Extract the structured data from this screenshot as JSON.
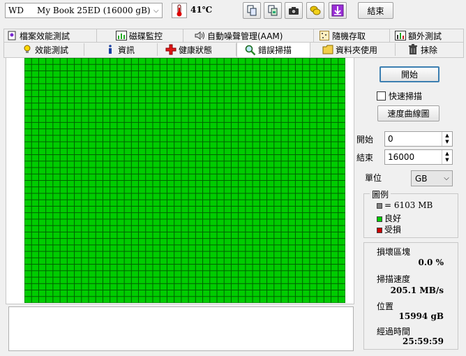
{
  "toolbar": {
    "drive_label": "WD     My Book 25ED (16000 gB)",
    "temperature": "41℃",
    "exit_label": "結束"
  },
  "tabs_row1": [
    {
      "label": "檔案效能測試"
    },
    {
      "label": "磁碟監控"
    },
    {
      "label": "自動噪聲管理(AAM)"
    },
    {
      "label": "隨機存取"
    },
    {
      "label": "額外測試"
    }
  ],
  "tabs_row2": [
    {
      "label": "效能測試"
    },
    {
      "label": "資訊"
    },
    {
      "label": "健康狀態"
    },
    {
      "label": "錯誤掃描"
    },
    {
      "label": "資料夾使用"
    },
    {
      "label": "抹除"
    }
  ],
  "scan": {
    "start_label": "開始",
    "quick_scan_label": "快速掃描",
    "quick_scan_checked": false,
    "speed_map_label": "速度曲線圖",
    "range_start_label": "開始",
    "range_start_value": "0",
    "range_end_label": "結束",
    "range_end_value": "16000",
    "unit_label": "單位",
    "unit_value": "GB",
    "grid_cols": 45,
    "grid_rows": 38,
    "block_color": "#00cc00"
  },
  "legend": {
    "title": "圖例",
    "items": [
      {
        "label": "= 6103 MB",
        "color": "#808080"
      },
      {
        "label": "良好",
        "color": "#00cc00"
      },
      {
        "label": "受損",
        "color": "#cc0000"
      }
    ]
  },
  "stats": {
    "damaged_label": "損壞區塊",
    "damaged_value": "0.0 %",
    "speed_label": "掃描速度",
    "speed_value": "205.1 MB/s",
    "position_label": "位置",
    "position_value": "15994 gB",
    "elapsed_label": "經過時間",
    "elapsed_value": "25:59:59"
  }
}
